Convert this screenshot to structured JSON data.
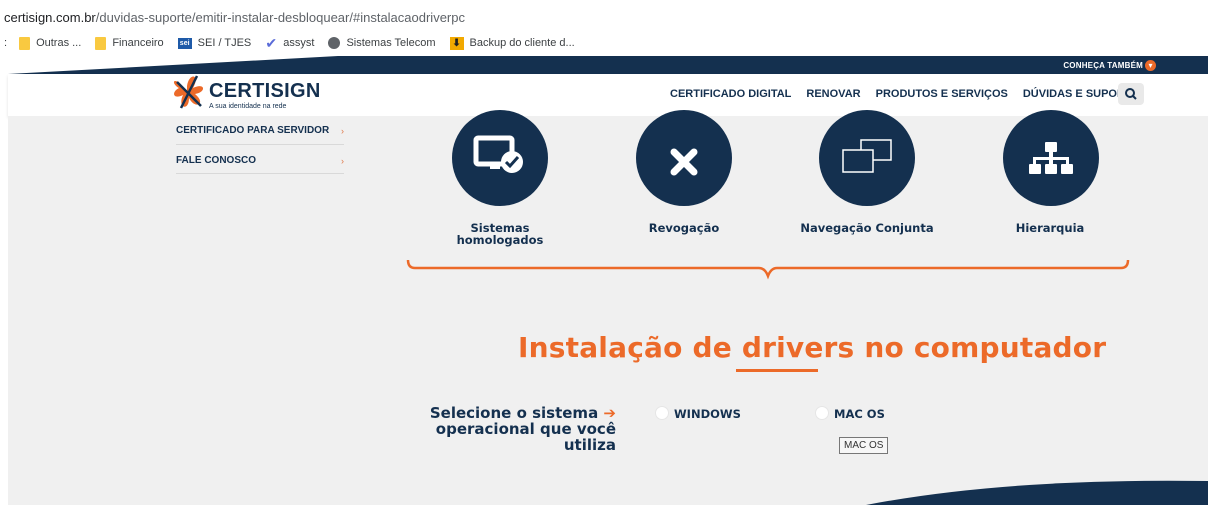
{
  "browser": {
    "url_host": "certisign.com.br",
    "url_path": "/duvidas-suporte/emitir-instalar-desbloquear/#instalacaodriverpc",
    "bookmarks_prefix": ":",
    "bookmarks": [
      {
        "label": "Outras ...",
        "icon": "folder-icon"
      },
      {
        "label": "Financeiro",
        "icon": "folder-icon"
      },
      {
        "label": "SEI / TJES",
        "icon": "sei-icon"
      },
      {
        "label": "assyst",
        "icon": "assyst-icon"
      },
      {
        "label": "Sistemas Telecom",
        "icon": "globe-icon"
      },
      {
        "label": "Backup do cliente d...",
        "icon": "backup-icon"
      }
    ]
  },
  "header": {
    "conheca": "CONHEÇA TAMBÉM",
    "logo_word": "CERTISIGN",
    "logo_tag": "A sua identidade na rede",
    "nav": [
      "CERTIFICADO DIGITAL",
      "RENOVAR",
      "PRODUTOS E SERVIÇOS",
      "DÚVIDAS E SUPORTE"
    ]
  },
  "sidebar": {
    "items": [
      "CERTIFICADO PARA SERVIDOR",
      "FALE CONOSCO"
    ]
  },
  "features": [
    {
      "label_1": "Sistemas",
      "label_2": "homologados",
      "icon": "monitor-check-icon"
    },
    {
      "label_1": "Revogação",
      "label_2": "",
      "icon": "close-icon"
    },
    {
      "label_1": "Navegação Conjunta",
      "label_2": "",
      "icon": "windows-icon"
    },
    {
      "label_1": "Hierarquia",
      "label_2": "",
      "icon": "hierarchy-icon"
    }
  ],
  "section": {
    "title": "Instalação de drivers no computador",
    "select_line1": "Selecione o sistema",
    "select_line2": "operacional que você utiliza",
    "options": [
      "WINDOWS",
      "MAC OS"
    ],
    "tooltip": "MAC OS"
  },
  "colors": {
    "navy": "#14304f",
    "accent": "#ec6a29",
    "page_bg": "#f0f0f0"
  }
}
